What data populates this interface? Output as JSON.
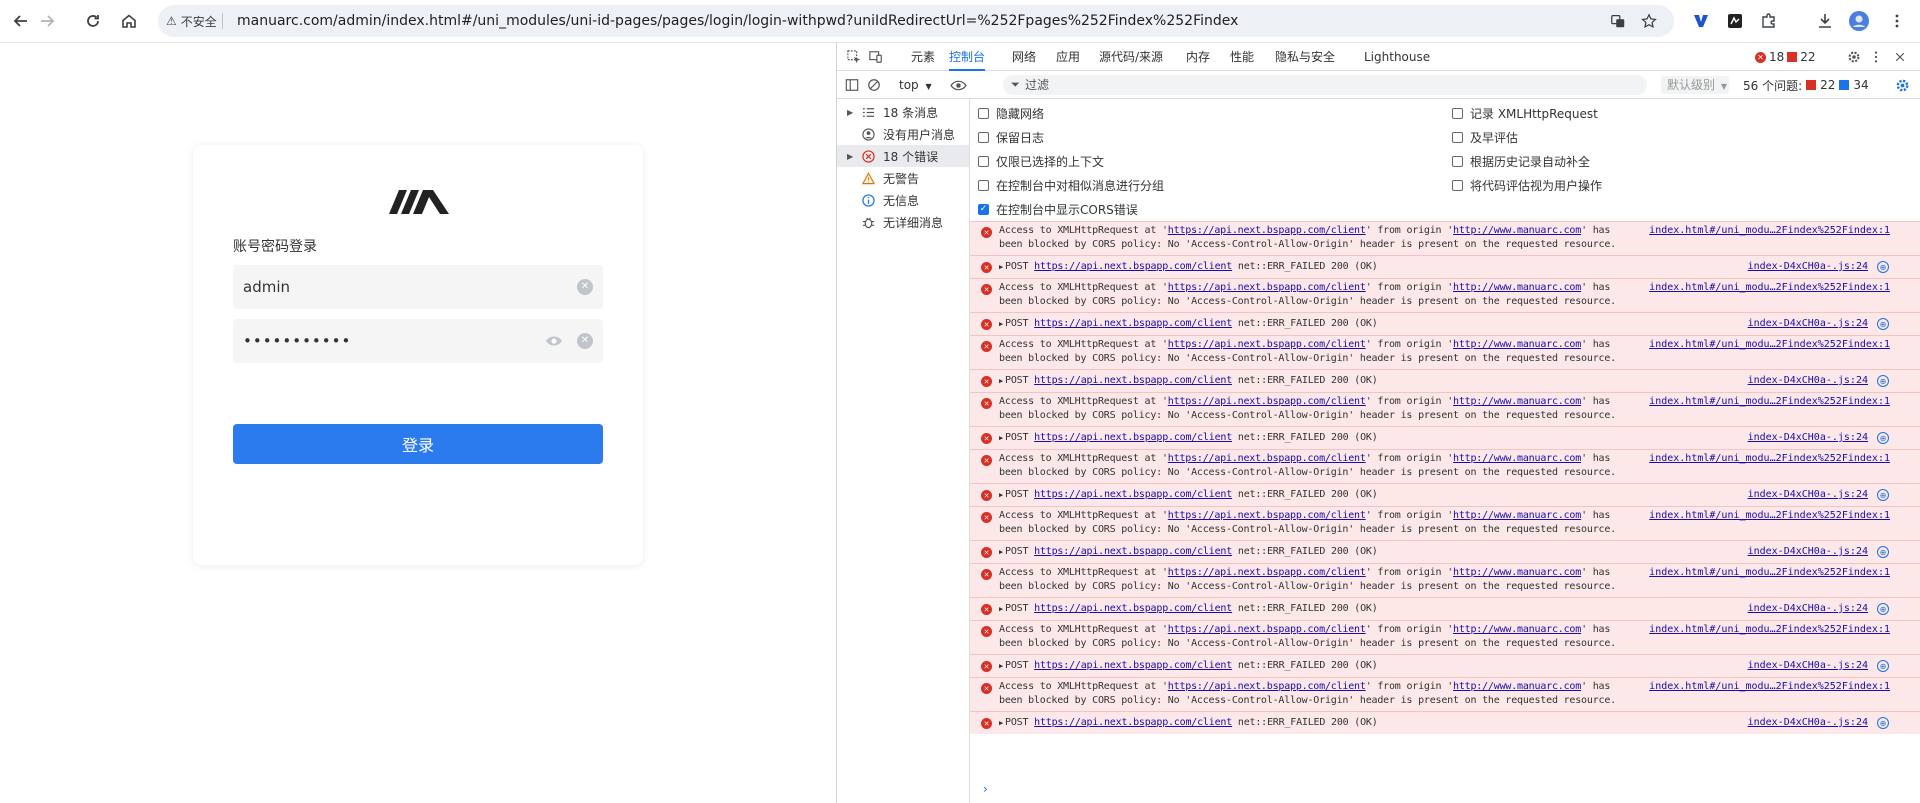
{
  "browser": {
    "security_label": "不安全",
    "url": "manuarc.com/admin/index.html#/uni_modules/uni-id-pages/pages/login/login-withpwd?uniIdRedirectUrl=%252Fpages%252Findex%252Findex"
  },
  "login": {
    "title": "账号密码登录",
    "username": "admin",
    "password": "•••••••••••",
    "button": "登录"
  },
  "devtools": {
    "tabs": [
      "元素",
      "控制台",
      "网络",
      "应用",
      "源代码/来源",
      "内存",
      "性能",
      "隐私与安全",
      "Lighthouse"
    ],
    "active_tab": "控制台",
    "error_count": "18",
    "issue_count": "22",
    "context": "top",
    "filter_placeholder": "过滤",
    "level": "默认级别",
    "issues_label": "56 个问题:",
    "issues_red": "22",
    "issues_blue": "34",
    "sidebar": [
      {
        "label": "18 条消息",
        "icon": "list-icon"
      },
      {
        "label": "没有用户消息",
        "icon": "user-icon"
      },
      {
        "label": "18 个错误",
        "icon": "error-icon"
      },
      {
        "label": "无警告",
        "icon": "warning-icon"
      },
      {
        "label": "无信息",
        "icon": "info-icon"
      },
      {
        "label": "无详细消息",
        "icon": "bug-icon"
      }
    ],
    "settings_left": [
      {
        "label": "隐藏网络",
        "checked": false
      },
      {
        "label": "保留日志",
        "checked": false
      },
      {
        "label": "仅限已选择的上下文",
        "checked": false
      },
      {
        "label": "在控制台中对相似消息进行分组",
        "checked": false
      },
      {
        "label": "在控制台中显示CORS错误",
        "checked": true
      }
    ],
    "settings_right": [
      {
        "label": "记录 XMLHttpRequest",
        "checked": false
      },
      {
        "label": "及早评估",
        "checked": false
      },
      {
        "label": "根据历史记录自动补全",
        "checked": false
      },
      {
        "label": "将代码评估视为用户操作",
        "checked": false
      }
    ],
    "cors_message": {
      "prefix": "Access to XMLHttpRequest at '",
      "url": "https://api.next.bspapp.com/client",
      "mid": "' from origin '",
      "origin": "http://www.manuarc.com",
      "suffix": "' has",
      "line2": "been blocked by CORS policy: No 'Access-Control-Allow-Origin' header is present on the requested resource.",
      "source": "index.html#/uni_modu…2Findex%252Findex:1"
    },
    "post_message": {
      "method": "POST",
      "url": "https://api.next.bspapp.com/client",
      "status": "net::ERR_FAILED 200 (OK)",
      "source": "index-D4xCH0a-.js:24"
    },
    "message_pairs": 9
  }
}
